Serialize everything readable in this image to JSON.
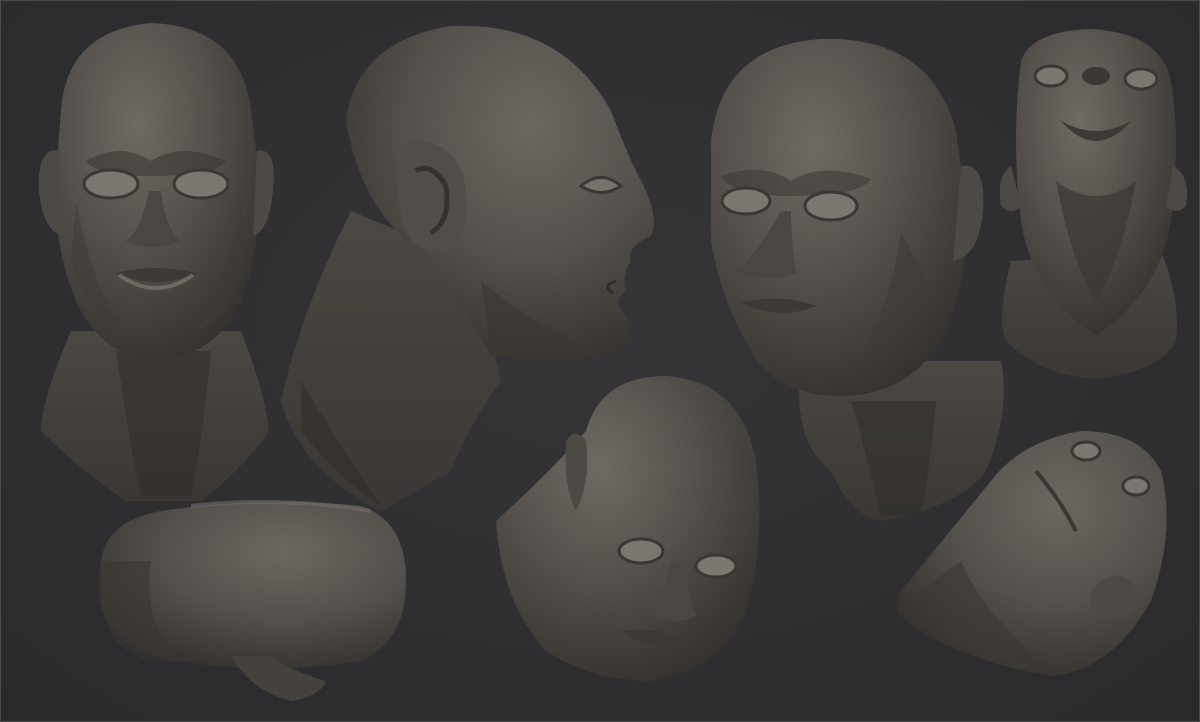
{
  "scene": {
    "background_color": "#2e2e30",
    "material_color": "#5a5550",
    "views": [
      {
        "name": "front-view"
      },
      {
        "name": "side-profile-view"
      },
      {
        "name": "three-quarter-view"
      },
      {
        "name": "upward-view"
      },
      {
        "name": "top-down-view"
      },
      {
        "name": "tilted-down-view"
      },
      {
        "name": "underside-view"
      }
    ]
  }
}
